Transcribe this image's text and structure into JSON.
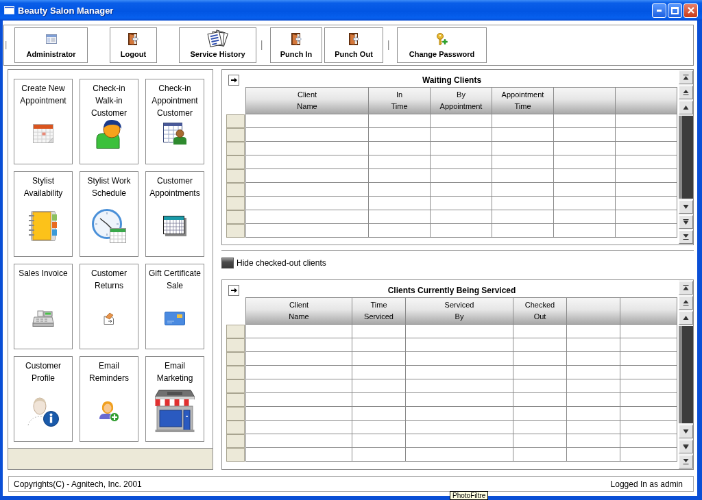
{
  "window": {
    "title": "Beauty Salon Manager"
  },
  "toolbar": {
    "groups": [
      [
        {
          "label": "Administrator"
        },
        {
          "label": "Logout"
        },
        {
          "label": "Service History"
        }
      ],
      [
        {
          "label": "Punch In"
        },
        {
          "label": "Punch Out"
        }
      ],
      [
        {
          "label": "Change Password"
        }
      ]
    ]
  },
  "tiles": [
    {
      "label": "Create New\nAppointment"
    },
    {
      "label": "Check-in\nWalk-in\nCustomer"
    },
    {
      "label": "Check-in\nAppointment\nCustomer"
    },
    {
      "label": "Stylist\nAvailability"
    },
    {
      "label": "Stylist Work\nSchedule"
    },
    {
      "label": "Customer\nAppointments"
    },
    {
      "label": "Sales Invoice"
    },
    {
      "label": "Customer\nReturns"
    },
    {
      "label": "Gift Certificate\nSale"
    },
    {
      "label": "Customer\nProfile"
    },
    {
      "label": "Email\nReminders"
    },
    {
      "label": "Email\nMarketing"
    }
  ],
  "waiting_clients": {
    "title": "Waiting Clients",
    "columns": [
      "Client\nName",
      "In\nTime",
      "By\nAppointment",
      "Appointment\nTime"
    ]
  },
  "hide_checked_out": {
    "label": "Hide checked-out clients",
    "checked": false
  },
  "clients_being_serviced": {
    "title": "Clients Currently Being Serviced",
    "columns": [
      "Client\nName",
      "Time\nServiced",
      "Serviced\nBy",
      "Checked\nOut"
    ]
  },
  "status_bar": {
    "copyright": "Copyrights(C) - Agnitech, Inc. 2001",
    "login_status": "Logged In as admin"
  },
  "tooltip": {
    "text": "PhotoFiltre"
  }
}
